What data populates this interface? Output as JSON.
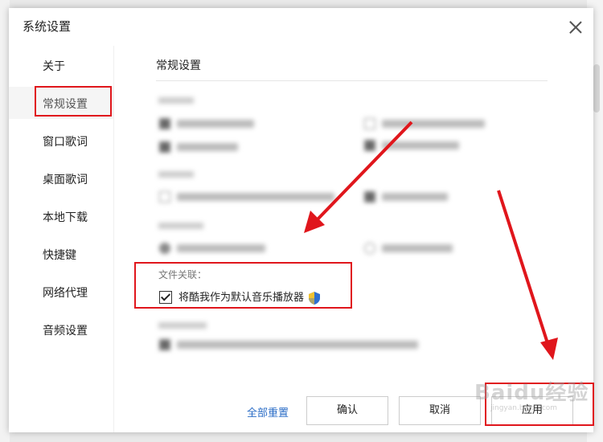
{
  "dialog": {
    "title": "系统设置"
  },
  "sidebar": {
    "items": [
      {
        "label": "关于",
        "active": false
      },
      {
        "label": "常规设置",
        "active": true
      },
      {
        "label": "窗口歌词",
        "active": false
      },
      {
        "label": "桌面歌词",
        "active": false
      },
      {
        "label": "本地下载",
        "active": false
      },
      {
        "label": "快捷键",
        "active": false
      },
      {
        "label": "网络代理",
        "active": false
      },
      {
        "label": "音频设置",
        "active": false
      }
    ]
  },
  "main": {
    "section_title": "常规设置",
    "file_association": {
      "label": "文件关联：",
      "option_label": "将酷我作为默认音乐播放器",
      "checked": true
    }
  },
  "footer": {
    "reset_label": "全部重置",
    "ok_label": "确认",
    "cancel_label": "取消",
    "apply_label": "应用"
  },
  "watermark": {
    "text": "Baidu经验",
    "sub": "jingyan.baidu.com"
  },
  "colors": {
    "annotation_red": "#e0161c",
    "link_blue": "#2a6cc6"
  }
}
